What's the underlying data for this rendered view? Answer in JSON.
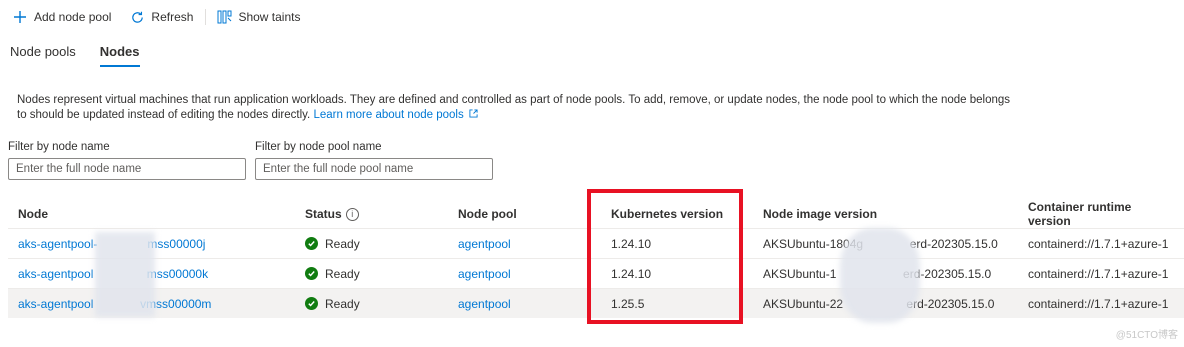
{
  "toolbar": {
    "add_node_pool": "Add node pool",
    "refresh": "Refresh",
    "show_taints": "Show taints"
  },
  "tabs": [
    {
      "label": "Node pools",
      "active": false
    },
    {
      "label": "Nodes",
      "active": true
    }
  ],
  "description": {
    "text": "Nodes represent virtual machines that run application workloads. They are defined and controlled as part of node pools. To add, remove, or update nodes, the node pool to which the node belongs to should be updated instead of editing the nodes directly.",
    "link": "Learn more about node pools"
  },
  "filters": {
    "node_name": {
      "label": "Filter by node name",
      "placeholder": "Enter the full node name",
      "value": ""
    },
    "node_pool_name": {
      "label": "Filter by node pool name",
      "placeholder": "Enter the full node pool name",
      "value": ""
    }
  },
  "table": {
    "columns": [
      "Node",
      "Status",
      "Node pool",
      "Kubernetes version",
      "Node image version",
      "Container runtime version"
    ],
    "rows": [
      {
        "node": "aks-agentpool-               mss00000j",
        "status": "Ready",
        "node_pool": "agentpool",
        "k8s_version": "1.24.10",
        "image_version": "AKSUbuntu-1804g              erd-202305.15.0",
        "runtime": "containerd://1.7.1+azure-1"
      },
      {
        "node": "aks-agentpool                mss00000k",
        "status": "Ready",
        "node_pool": "agentpool",
        "k8s_version": "1.24.10",
        "image_version": "AKSUbuntu-1                    erd-202305.15.0",
        "runtime": "containerd://1.7.1+azure-1"
      },
      {
        "node": "aks-agentpool              vmss00000m",
        "status": "Ready",
        "node_pool": "agentpool",
        "k8s_version": "1.25.5",
        "image_version": "AKSUbuntu-22                   erd-202305.15.0",
        "runtime": "containerd://1.7.1+azure-1"
      }
    ]
  },
  "colors": {
    "accent": "#0078d4",
    "ready": "#107c10",
    "highlight": "#e81123"
  },
  "watermark": "@51CTO博客"
}
